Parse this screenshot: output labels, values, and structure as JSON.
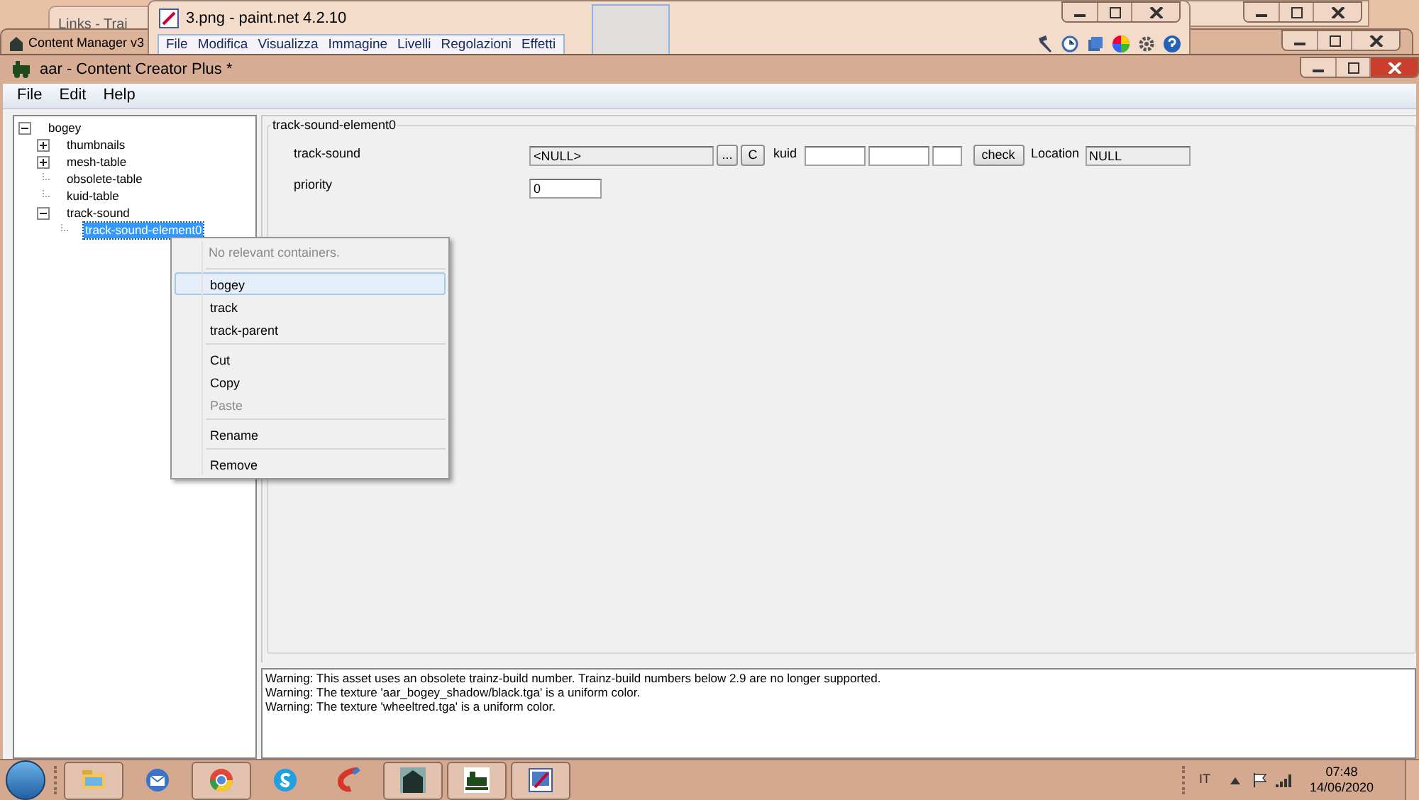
{
  "background_windows": [
    {
      "title": "Links - Trai"
    },
    {
      "title": "Content Manager v3"
    }
  ],
  "paint_window": {
    "title": "3.png - paint.net 4.2.10",
    "menu": [
      "File",
      "Modifica",
      "Visualizza",
      "Immagine",
      "Livelli",
      "Regolazioni",
      "Effetti"
    ]
  },
  "window": {
    "title": "aar - Content Creator Plus *"
  },
  "menu": [
    "File",
    "Edit",
    "Help"
  ],
  "tree": [
    {
      "label": "bogey",
      "expanded": true,
      "selected": false,
      "children": [
        {
          "label": "thumbnails",
          "expanded": false,
          "selected": false
        },
        {
          "label": "mesh-table",
          "expanded": false,
          "selected": false
        },
        {
          "label": "obsolete-table",
          "selected": false
        },
        {
          "label": "kuid-table",
          "selected": false
        },
        {
          "label": "track-sound",
          "expanded": true,
          "selected": false,
          "children": [
            {
              "label": "track-sound-element0",
              "selected": true
            }
          ]
        }
      ]
    }
  ],
  "group": {
    "title": "track-sound-element0",
    "track_sound": {
      "label": "track-sound",
      "value": "<NULL>",
      "browse_button": "...",
      "clear_button": "C",
      "kuid_label": "kuid",
      "check_button": "check",
      "location_label": "Location",
      "location_value": "NULL"
    },
    "priority": {
      "label": "priority",
      "value": "0"
    }
  },
  "context_menu": [
    {
      "kind": "note",
      "label": "No relevant containers."
    },
    {
      "kind": "separator"
    },
    {
      "kind": "item",
      "label": "bogey",
      "selected": true,
      "disabled": false
    },
    {
      "kind": "item",
      "label": "track",
      "selected": false,
      "disabled": false
    },
    {
      "kind": "item",
      "label": "track-parent",
      "selected": false,
      "disabled": false
    },
    {
      "kind": "separator"
    },
    {
      "kind": "item",
      "label": "Cut",
      "selected": false,
      "disabled": false
    },
    {
      "kind": "item",
      "label": "Copy",
      "selected": false,
      "disabled": false
    },
    {
      "kind": "item",
      "label": "Paste",
      "selected": false,
      "disabled": true
    },
    {
      "kind": "separator"
    },
    {
      "kind": "item",
      "label": "Rename",
      "selected": false,
      "disabled": false
    },
    {
      "kind": "separator"
    },
    {
      "kind": "item",
      "label": "Remove",
      "selected": false,
      "disabled": false
    }
  ],
  "log": [
    "Warning: This asset uses an obsolete trainz-build number. Trainz-build numbers below 2.9 are no longer supported.",
    "Warning: The texture 'aar_bogey_shadow/black.tga' is a uniform color.",
    "Warning: The texture 'wheeltred.tga' is a uniform color."
  ],
  "tray": {
    "language": "IT",
    "time": "07:48",
    "date": "14/06/2020"
  }
}
